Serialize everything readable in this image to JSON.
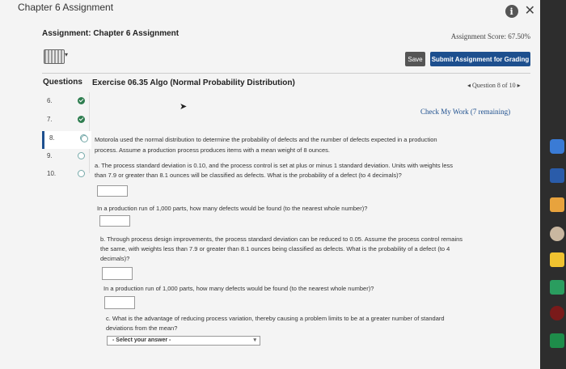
{
  "window": {
    "title": "Chapter 6 Assignment"
  },
  "header": {
    "assignment_title": "Assignment: Chapter 6 Assignment",
    "score": "Assignment Score: 67.50%"
  },
  "toolbar": {
    "save_label": "Save",
    "submit_label": "Submit Assignment for Grading"
  },
  "question_panel": {
    "questions_label": "Questions",
    "exercise_title": "Exercise 06.35 Algo (Normal Probability Distribution)",
    "nav": "◂ Question 8 of 10 ▸",
    "check_work": "Check My Work (7 remaining)"
  },
  "sidebar": {
    "items": [
      {
        "num": "6.",
        "status": "complete"
      },
      {
        "num": "7.",
        "status": "complete"
      },
      {
        "num": "8.",
        "status": "current"
      },
      {
        "num": "9.",
        "status": "incomplete"
      },
      {
        "num": "10.",
        "status": "incomplete"
      }
    ]
  },
  "problem": {
    "intro_1": "Motorola used the normal distribution to determine the probability of defects and the number of defects expected in a production",
    "intro_2": "process. Assume a production process produces items with a mean weight of 8 ounces.",
    "a_1": "a. The process standard deviation is 0.10, and the process control is set at plus or minus 1 standard deviation. Units with weights less",
    "a_2": "than 7.9 or greater than 8.1 ounces will be classified as defects. What is the probability of a defect (to 4 decimals)?",
    "a_count": "In a production run of 1,000 parts, how many defects would be found (to the nearest whole number)?",
    "b_1": "b. Through process design improvements, the process standard deviation can be reduced to 0.05. Assume the process control remains",
    "b_2": "the same, with weights less than 7.9 or greater than 8.1 ounces being classified as defects. What is the probability of a defect (to 4",
    "b_3": "decimals)?",
    "b_count": "In a production run of 1,000 parts, how many defects would be found (to the nearest whole number)?",
    "c_1": "c. What is the advantage of reducing process variation, thereby causing a problem limits to be at a greater number of standard",
    "c_2": "deviations from the mean?",
    "select_placeholder": "- Select your answer -"
  },
  "colors": {
    "accent": "#1d4f8e",
    "complete": "#2e7d4f"
  }
}
